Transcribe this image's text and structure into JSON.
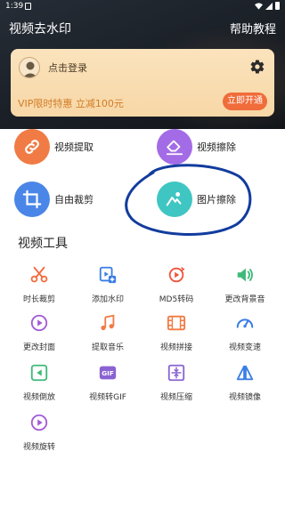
{
  "status": {
    "time": "1:39"
  },
  "header": {
    "title": "视频去水印",
    "help": "帮助教程"
  },
  "vip": {
    "login": "点击登录",
    "promo": "VIP限时特惠 立减100元",
    "button": "立即开通"
  },
  "main": [
    {
      "label": "视频提取",
      "icon": "link-icon",
      "color": "#f07b45"
    },
    {
      "label": "视频擦除",
      "icon": "eraser-icon",
      "color": "#a36be6"
    },
    {
      "label": "自由裁剪",
      "icon": "crop-icon",
      "color": "#4a86e8"
    },
    {
      "label": "图片擦除",
      "icon": "image-edit-icon",
      "color": "#3fc6c2"
    }
  ],
  "section_title": "视频工具",
  "tools": [
    {
      "label": "时长裁剪",
      "icon": "scissors-icon"
    },
    {
      "label": "添加水印",
      "icon": "add-watermark-icon"
    },
    {
      "label": "MD5转码",
      "icon": "md5-icon"
    },
    {
      "label": "更改背景音",
      "icon": "speaker-icon"
    },
    {
      "label": "更改封面",
      "icon": "cover-icon"
    },
    {
      "label": "提取音乐",
      "icon": "music-note-icon"
    },
    {
      "label": "视频拼接",
      "icon": "film-join-icon"
    },
    {
      "label": "视频变速",
      "icon": "speedometer-icon"
    },
    {
      "label": "视频倒放",
      "icon": "reverse-play-icon"
    },
    {
      "label": "视频转GIF",
      "icon": "gif-icon"
    },
    {
      "label": "视频压缩",
      "icon": "compress-icon"
    },
    {
      "label": "视频镜像",
      "icon": "mirror-icon"
    },
    {
      "label": "视频旋转",
      "icon": "rotate-icon"
    }
  ]
}
